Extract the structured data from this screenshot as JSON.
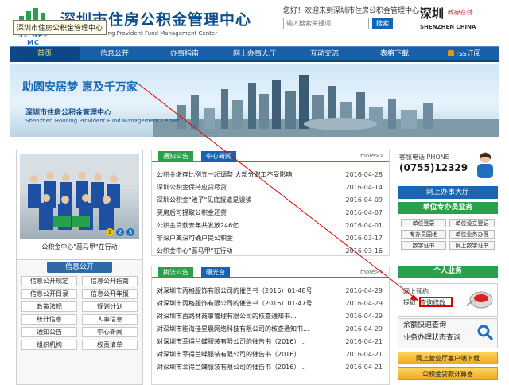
{
  "header": {
    "site_title": "深圳市住房公积金管理中心",
    "site_sub": "Housing Provident Fund Management Center",
    "logo_text": "SZ HPF MC",
    "tooltip": "深圳市住房公积金管理中心",
    "welcome": "您好！欢迎来到深圳市住房公积金管理中心！",
    "search_placeholder": "输入搜索关键词",
    "search_button": "搜索",
    "sz_logo_cn": "深圳",
    "sz_logo_fn": "政府在线",
    "sz_logo_en": "SHENZHEN CHINA"
  },
  "nav": [
    "首页",
    "信息公开",
    "办事指南",
    "网上办事大厅",
    "互动交流",
    "表格下载",
    "rss订阅"
  ],
  "banner": {
    "slogan": "助圆安居梦  惠及千万家",
    "title": "深圳市住房公积金管理中心",
    "title_en": "Shenzhen Housing Provident Fund Management Center"
  },
  "photo": {
    "caption": "公积金中心\"蕊马甲\"在行动",
    "dots": [
      "1",
      "2",
      "3"
    ]
  },
  "info_public": {
    "title": "信息公开",
    "items": [
      "信息公开规定",
      "信息公开指南",
      "信息公开目录",
      "信息公开年报",
      "政策法规",
      "规划计划",
      "统计信息",
      "人事信息",
      "通知公告",
      "中心新闻",
      "组织机构",
      "权责清单"
    ]
  },
  "notice": {
    "tabs": [
      "通知公告",
      "中心新闻"
    ],
    "more": "more>>",
    "items": [
      {
        "title": "公积金缴存比例五一起调整 大部分职工不受影响",
        "date": "2016-04-28"
      },
      {
        "title": "深圳公积金保持应贷尽贷",
        "date": "2016-04-14"
      },
      {
        "title": "深圳公积金\"池子\"见底报道是误读",
        "date": "2016-04-09"
      },
      {
        "title": "买房后可提取公积金还贷",
        "date": "2016-04-07"
      },
      {
        "title": "公积金贷款去年共发放246亿",
        "date": "2016-04-01"
      },
      {
        "title": "非深户离深可确户提公积金",
        "date": "2016-03-17"
      },
      {
        "title": "公积金中心\"蕊马甲\"在行动",
        "date": "2016-03-16"
      }
    ]
  },
  "enforcement": {
    "tabs": [
      "执法公告",
      "曝光台"
    ],
    "more": "more>>",
    "items": [
      {
        "title": "对深圳市丙格服饰有限公司的催告书（2016）01-48号",
        "date": "2016-04-29"
      },
      {
        "title": "对深圳市丙格服饰有限公司的催告书（2016）01-47号",
        "date": "2016-04-29"
      },
      {
        "title": "对深圳市西路林商事管理有限公司的核查通知书...",
        "date": "2016-04-29"
      },
      {
        "title": "对深圳市能海佳星晨网络科技有限公司的核查通知书...",
        "date": "2016-04-29"
      },
      {
        "title": "对深圳市菲得兰蝶服装有限公司的催告书（2016）...",
        "date": "2016-04-21"
      },
      {
        "title": "对深圳市菲得兰蝶服装有限公司的催告书（2016）...",
        "date": "2016-04-21"
      },
      {
        "title": "对深圳市菲得兰蝶服装有限公司的催告书（2016）...",
        "date": "2016-04-21"
      }
    ]
  },
  "sidebar": {
    "phone_label": "客服电话 PHONE",
    "phone_number": "(0755)12329",
    "hall_title": "网上办事大厅",
    "unit_title": "单位专办员业务",
    "unit_buttons": [
      "单位登录",
      "单位设立登记",
      "专办员园地",
      "单位业务办理",
      "数字证书",
      "网上数字证书"
    ],
    "personal_title": "个人业务",
    "appt_l1": "网上预约",
    "appt_l2a": "提取",
    "appt_l2b": "查询修改",
    "ywkd_1": "余额快速查询",
    "ywkd_2": "业务办理状态查询",
    "wsyy": "网上营业厅客户端下载",
    "calc": "公积金贷款计算器"
  }
}
